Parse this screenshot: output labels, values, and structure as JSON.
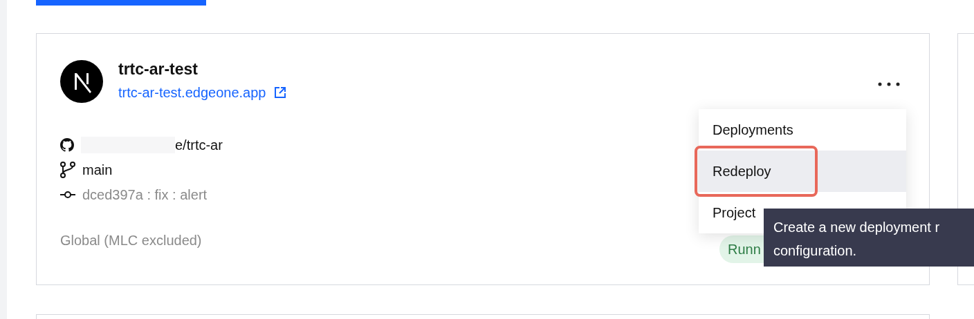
{
  "project": {
    "name": "trtc-ar-test",
    "url": "trtc-ar-test.edgeone.app",
    "repo": "e/trtc-ar",
    "branch": "main",
    "commit": "dced397a : fix : alert",
    "region": "Global (MLC excluded)",
    "status": "Runn"
  },
  "menu": [
    {
      "label": "Deployments",
      "selected": false,
      "annotated": false
    },
    {
      "label": "Redeploy",
      "selected": true,
      "annotated": true
    },
    {
      "label": "Project",
      "selected": false,
      "annotated": false
    }
  ],
  "tooltip": {
    "lines": [
      "Create a new deployment r",
      "configuration."
    ]
  }
}
